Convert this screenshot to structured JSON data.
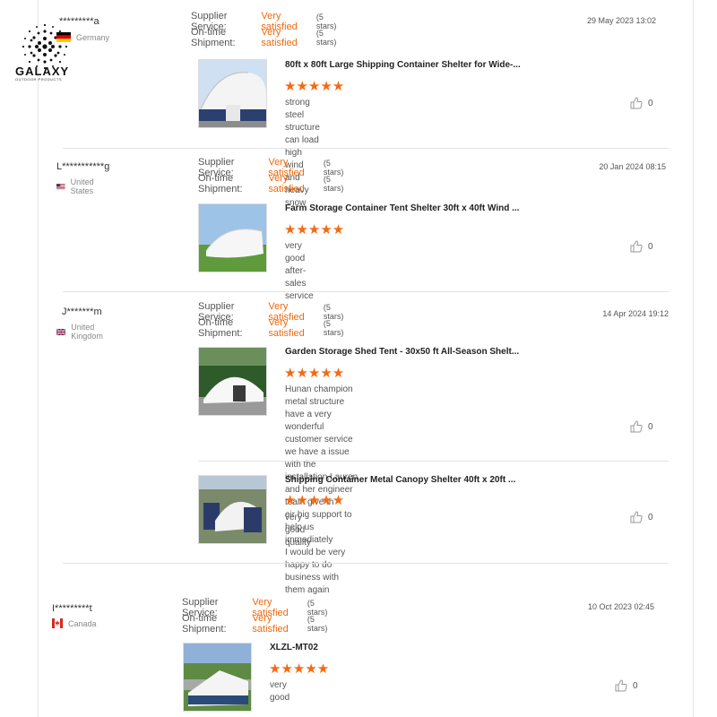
{
  "logo": {
    "name": "GALAXY",
    "tagline": "OUTDOOR PRODUCTS"
  },
  "rating_labels": {
    "supplier": "Supplier Service:",
    "shipment": "On-time Shipment:"
  },
  "reviews": [
    {
      "user": "*********a",
      "country": "Germany",
      "supplier_value": "Very satisfied",
      "supplier_stars": "(5 stars)",
      "shipment_value": "Very satisfied",
      "shipment_stars": "(5 stars)",
      "date": "29 May 2023 13:02",
      "products": [
        {
          "title": "80ft x 80ft Large Shipping Container Shelter for Wide-...",
          "rating": 5,
          "comment": "strong steel structure can load high wind and heavy snow",
          "likes": "0"
        }
      ]
    },
    {
      "user": "L***********g",
      "country": "United States",
      "supplier_value": "Very satisfied",
      "supplier_stars": "(5 stars)",
      "shipment_value": "Very satisfied",
      "shipment_stars": "(5 stars)",
      "date": "20 Jan 2024 08:15",
      "products": [
        {
          "title": "Farm Storage Container Tent Shelter 30ft x 40ft Wind ...",
          "rating": 5,
          "comment": "very good after-sales service",
          "likes": "0"
        }
      ]
    },
    {
      "user": "J*******m",
      "country": "United Kingdom",
      "supplier_value": "Very satisfied",
      "supplier_stars": "(5 stars)",
      "shipment_value": "Very satisfied",
      "shipment_stars": "(5 stars)",
      "date": "14 Apr 2024 19:12",
      "products": [
        {
          "title": "Garden Storage Shed Tent - 30x50 ft All-Season Shelt...",
          "rating": 5,
          "comment": "Hunan champion metal structure have a very wonderful customer service\nwe have a issue with the installation.Lauren and her engineer team give th\neir big support to help us immediately\nI would be very happy to do business with them again",
          "likes": "0"
        },
        {
          "title": "Shipping Container Metal Canopy Shelter 40ft x 20ft ...",
          "rating": 5,
          "comment": "very good quality",
          "likes": "0"
        }
      ]
    },
    {
      "user": "I*********t",
      "country": "Canada",
      "supplier_value": "Very satisfied",
      "supplier_stars": "(5 stars)",
      "shipment_value": "Very satisfied",
      "shipment_stars": "(5 stars)",
      "date": "10 Oct 2023 02:45",
      "products": [
        {
          "title": "XLZL-MT02",
          "rating": 5,
          "comment": "very good",
          "likes": "0"
        }
      ]
    }
  ],
  "star_glyphs": "★★★★★",
  "icons": [
    "thumbs-up-icon",
    "flag-germany",
    "flag-usa",
    "flag-uk",
    "flag-canada"
  ],
  "colors": {
    "accent": "#f06a0f",
    "star": "#f26a13",
    "divider": "#e3e3e3"
  }
}
